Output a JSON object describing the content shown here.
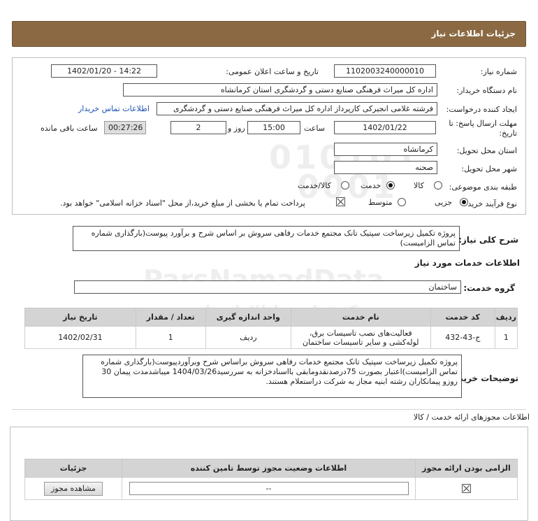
{
  "header": {
    "title": "جزئیات اطلاعات نیاز"
  },
  "watermark": {
    "digits_top": "010101",
    "digits_bottom": "0001",
    "brand": "ParsNamadData",
    "fa_top": "مرکز فراوری اطلاعات پارس",
    "fa_bottom": "پایگاه رسانی مناقصه مزایده"
  },
  "form": {
    "need_number_label": "شماره نیاز:",
    "need_number": "1102003240000010",
    "announce_label": "تاریخ و ساعت اعلان عمومی:",
    "announce_value": "1402/01/20 - 14:22",
    "buyer_label": "نام دستگاه خریدار:",
    "buyer_value": "اداره کل میراث فرهنگی  صنایع دستی و گردشگری استان کرمانشاه",
    "creator_label": "ایجاد کننده درخواست:",
    "creator_value": "فرشته غلامی انجیرکی کارپرداز اداره کل میراث فرهنگی  صنایع دستی و گردشگری",
    "contact_link": "اطلاعات تماس خریدار",
    "deadline_label": "مهلت ارسال پاسخ: تا",
    "deadline_label2": "تاریخ:",
    "deadline_date": "1402/01/22",
    "time_label": "ساعت",
    "deadline_time": "15:00",
    "day_label": "روز و",
    "days": "2",
    "remaining_time": "00:27:26",
    "remaining_label": "ساعت باقی مانده",
    "province_label": "استان محل تحویل:",
    "province_value": "کرمانشاه",
    "city_label": "شهر محل تحویل:",
    "city_value": "صحنه",
    "category_label": "طبقه بندی موضوعی:",
    "category_options": [
      "کالا",
      "خدمت",
      "کالا/خدمت"
    ],
    "category_selected": "خدمت",
    "process_label": "نوع فرآیند خرید :",
    "process_options": [
      "جزیی",
      "متوسط"
    ],
    "process_selected": "جزیی",
    "payment_note": "پرداخت تمام یا بخشی از مبلغ خرید،از محل \"اسناد خزانه اسلامی\" خواهد بود."
  },
  "summary": {
    "label": "شرح کلی نیاز:",
    "text": "پروژه تکمیل زیرساخت سپتیک تانک مجتمع خدمات رفاهی سروش بر اساس شرح و برآورد پیوست(بارگذاری شماره تماس الزامیست)"
  },
  "services": {
    "section_title": "اطلاعات خدمات مورد نیاز",
    "group_label": "گروه خدمت:",
    "group_value": "ساختمان",
    "table": {
      "headers": [
        "ردیف",
        "کد خدمت",
        "نام خدمت",
        "واحد اندازه گیری",
        "تعداد / مقدار",
        "تاریخ نیاز"
      ],
      "rows": [
        [
          "1",
          "ج-43-432",
          "فعالیت‌های نصب تاسیسات برق، لوله‌کشی و سایر تاسیسات ساختمان",
          "ردیف",
          "1",
          "1402/02/31"
        ]
      ]
    }
  },
  "buyer_notes": {
    "label": "توضیحات خریدار:",
    "text": "پروژه تکمیل زیرساخت سپتیک تانک مجتمع خدمات رفاهی سروش براساس شرح وبرآوردپیوست(بارگذاری شماره تماس الزامیست)اعتبار بصورت 75درصدنقدومابقی بااسنادخزانه به سررسید1404/03/26 میباشدمدت پیمان 30 روزو پیمانکاران رشته ابنیه مجاز به شرکت دراستعلام هستند."
  },
  "permits": {
    "section_title": "اطلاعات مجوزهای ارائه خدمت / کالا",
    "headers": [
      "الزامی بودن ارائه مجوز",
      "اطلاعات وضعیت مجوز توسط تامین کننده",
      "جزئیات"
    ],
    "status_value": "--",
    "view_button": "مشاهده مجوز"
  }
}
